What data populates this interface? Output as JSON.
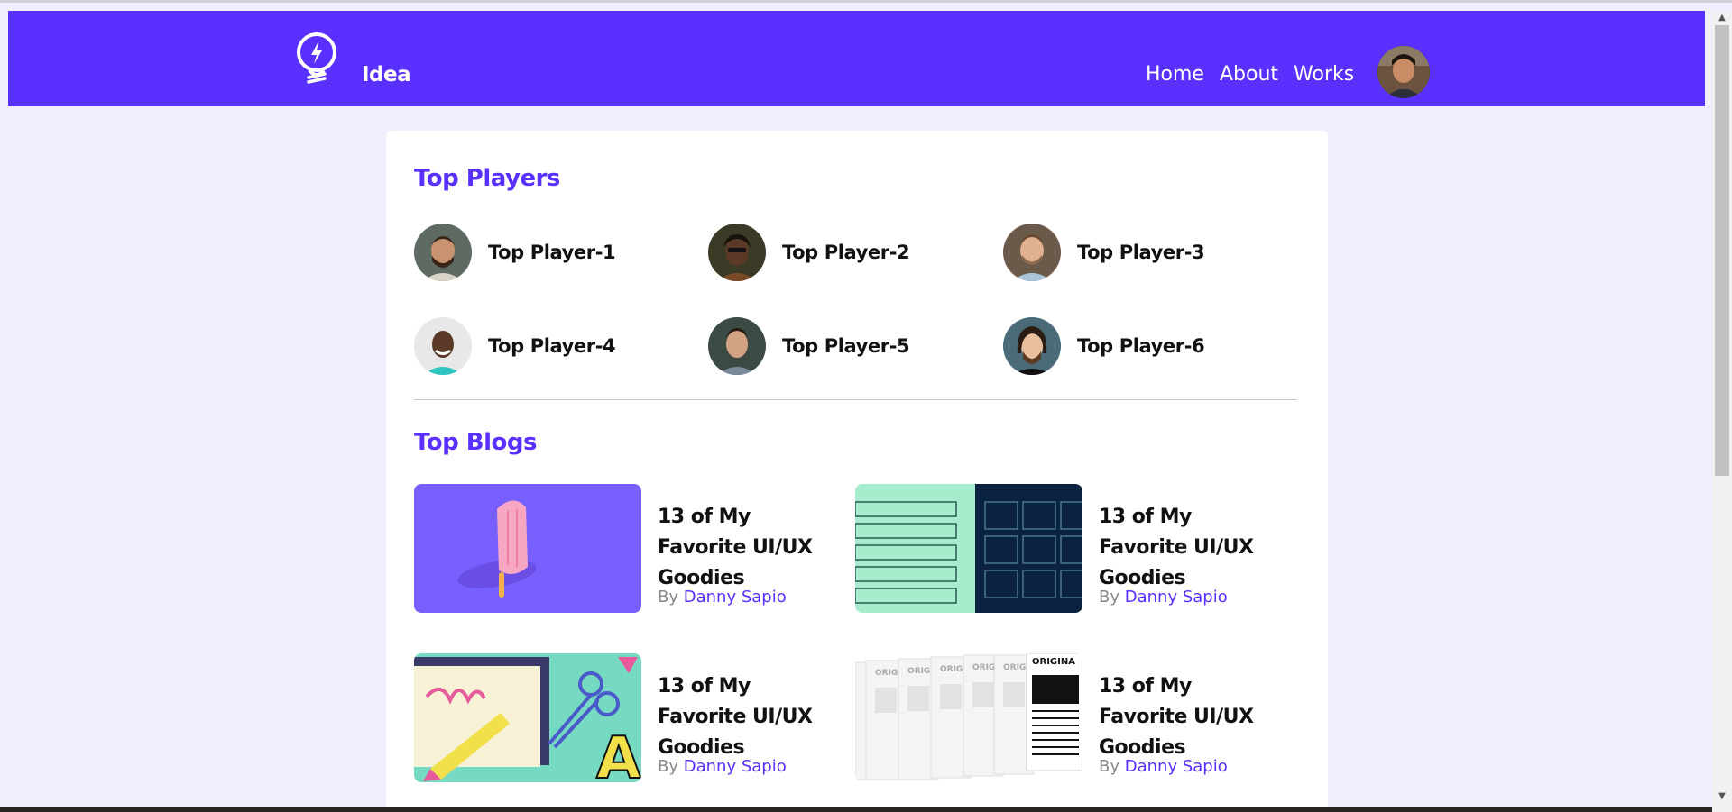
{
  "header": {
    "logo_text": "Idea",
    "nav": [
      {
        "label": "Home"
      },
      {
        "label": "About"
      },
      {
        "label": "Works"
      }
    ],
    "colors": {
      "brand": "#5a30ff",
      "background": "#f1efff"
    }
  },
  "players": {
    "title": "Top Players",
    "items": [
      {
        "name": "Top Player-1"
      },
      {
        "name": "Top Player-2"
      },
      {
        "name": "Top Player-3"
      },
      {
        "name": "Top Player-4"
      },
      {
        "name": "Top Player-5"
      },
      {
        "name": "Top Player-6"
      }
    ]
  },
  "blogs": {
    "title": "Top Blogs",
    "items": [
      {
        "title": "13 of My Favorite UI/UX Goodies",
        "by": "By",
        "author": "Danny Sapio"
      },
      {
        "title": "13 of My Favorite UI/UX Goodies",
        "by": "By",
        "author": "Danny Sapio"
      },
      {
        "title": "13 of My Favorite UI/UX Goodies",
        "by": "By",
        "author": "Danny Sapio"
      },
      {
        "title": "13 of My Favorite UI/UX Goodies",
        "by": "By",
        "author": "Danny Sapio"
      }
    ],
    "thumb4_text": "ORIGINA",
    "thumb4_faded_text": "ORIG"
  }
}
